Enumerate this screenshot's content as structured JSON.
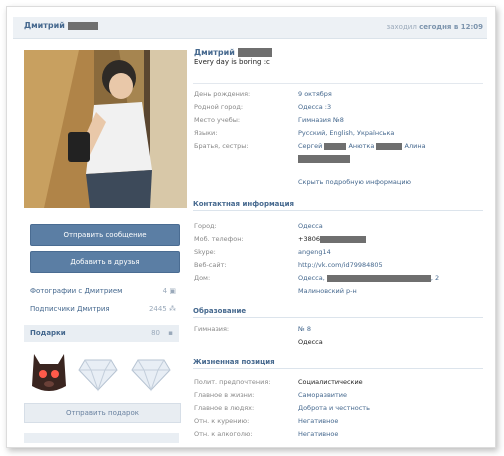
{
  "header": {
    "name": "Дмитрий",
    "status_prefix": "заходил",
    "status_suffix": "сегодня в 12:09"
  },
  "left": {
    "send_message": "Отправить сообщение",
    "add_friend": "Добавить в друзья",
    "photos_label": "Фотографии с Дмитрием",
    "photos_count": "4",
    "subscribers_label": "Подписчики Дмитрия",
    "subscribers_count": "2445",
    "gifts_label": "Подарки",
    "gifts_count": "80",
    "send_gift": "Отправить подарок"
  },
  "profile": {
    "name": "Дмитрий",
    "status": "Every day is boring :c",
    "birthday_label": "День рождения:",
    "birthday": "9 октября",
    "hometown_label": "Родной город:",
    "hometown": "Одесса :3",
    "study_label": "Место учебы:",
    "study": "Гимназия №8",
    "languages_label": "Языки:",
    "languages": "Русский, English, Українська",
    "siblings_label": "Братья, сестры:",
    "sibling1": "Сергей",
    "sibling2": "Анютка",
    "sibling3": "Алина",
    "hide_info": "Скрыть подробную информацию"
  },
  "contacts": {
    "title": "Контактная информация",
    "city_label": "Город:",
    "city": "Одесса",
    "phone_label": "Моб. телефон:",
    "phone": "+3806",
    "skype_label": "Skype:",
    "skype": "angeng14",
    "website_label": "Веб-сайт:",
    "website": "http://vk.com/id79984805",
    "home_label": "Дом:",
    "home": "Одесса,",
    "home_suffix": ", 2",
    "district": "Малиновский р-н"
  },
  "education": {
    "title": "Образование",
    "school_label": "Гимназия:",
    "school": "№ 8",
    "school_city": "Одесса"
  },
  "position": {
    "title": "Жизненная позиция",
    "politics_label": "Полит. предпочтения:",
    "politics": "Социалистические",
    "life_label": "Главное в жизни:",
    "life": "Саморазвитие",
    "people_label": "Главное в людях:",
    "people": "Доброта и честность",
    "smoking_label": "Отн. к курению:",
    "smoking": "Негативное",
    "alcohol_label": "Отн. к алкоголю:",
    "alcohol": "Негативное"
  },
  "colors": {
    "accent": "#45688e",
    "button": "#5b7ea4"
  }
}
